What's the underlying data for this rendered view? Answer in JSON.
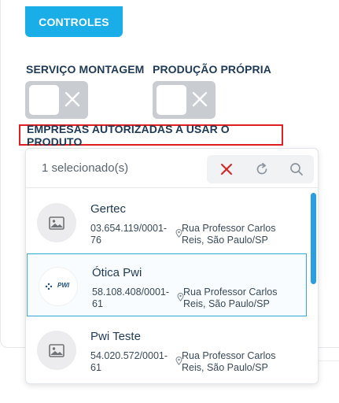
{
  "tab": {
    "label": "CONTROLES"
  },
  "fields": {
    "servico_montagem": {
      "label": "SERVIÇO MONTAGEM",
      "value": false
    },
    "producao_propria": {
      "label": "PRODUÇÃO PRÓPRIA",
      "value": false
    }
  },
  "companies": {
    "label": "EMPRESAS AUTORIZADAS A USAR O PRODUTO",
    "selected_count_text": "1 selecionado(s)",
    "items": [
      {
        "name": "Gertec",
        "cnpj": "03.654.119/0001-76",
        "address": "Rua Professor Carlos Reis, São Paulo/SP",
        "selected": false,
        "avatar": "image-placeholder-icon"
      },
      {
        "name": "Ótica Pwi",
        "cnpj": "58.108.408/0001-61",
        "address": "Rua Professor Carlos Reis, São Paulo/SP",
        "selected": true,
        "avatar": "pwi-logo",
        "logo_text": "PWI"
      },
      {
        "name": "Pwi Teste",
        "cnpj": "54.020.572/0001-61",
        "address": "Rua Professor Carlos Reis, São Paulo/SP",
        "selected": false,
        "avatar": "image-placeholder-icon"
      }
    ]
  },
  "colors": {
    "accent": "#1aaee8",
    "clear": "#e02020",
    "highlight_border": "#e02020",
    "toggle_off": "#c9ccd0"
  }
}
